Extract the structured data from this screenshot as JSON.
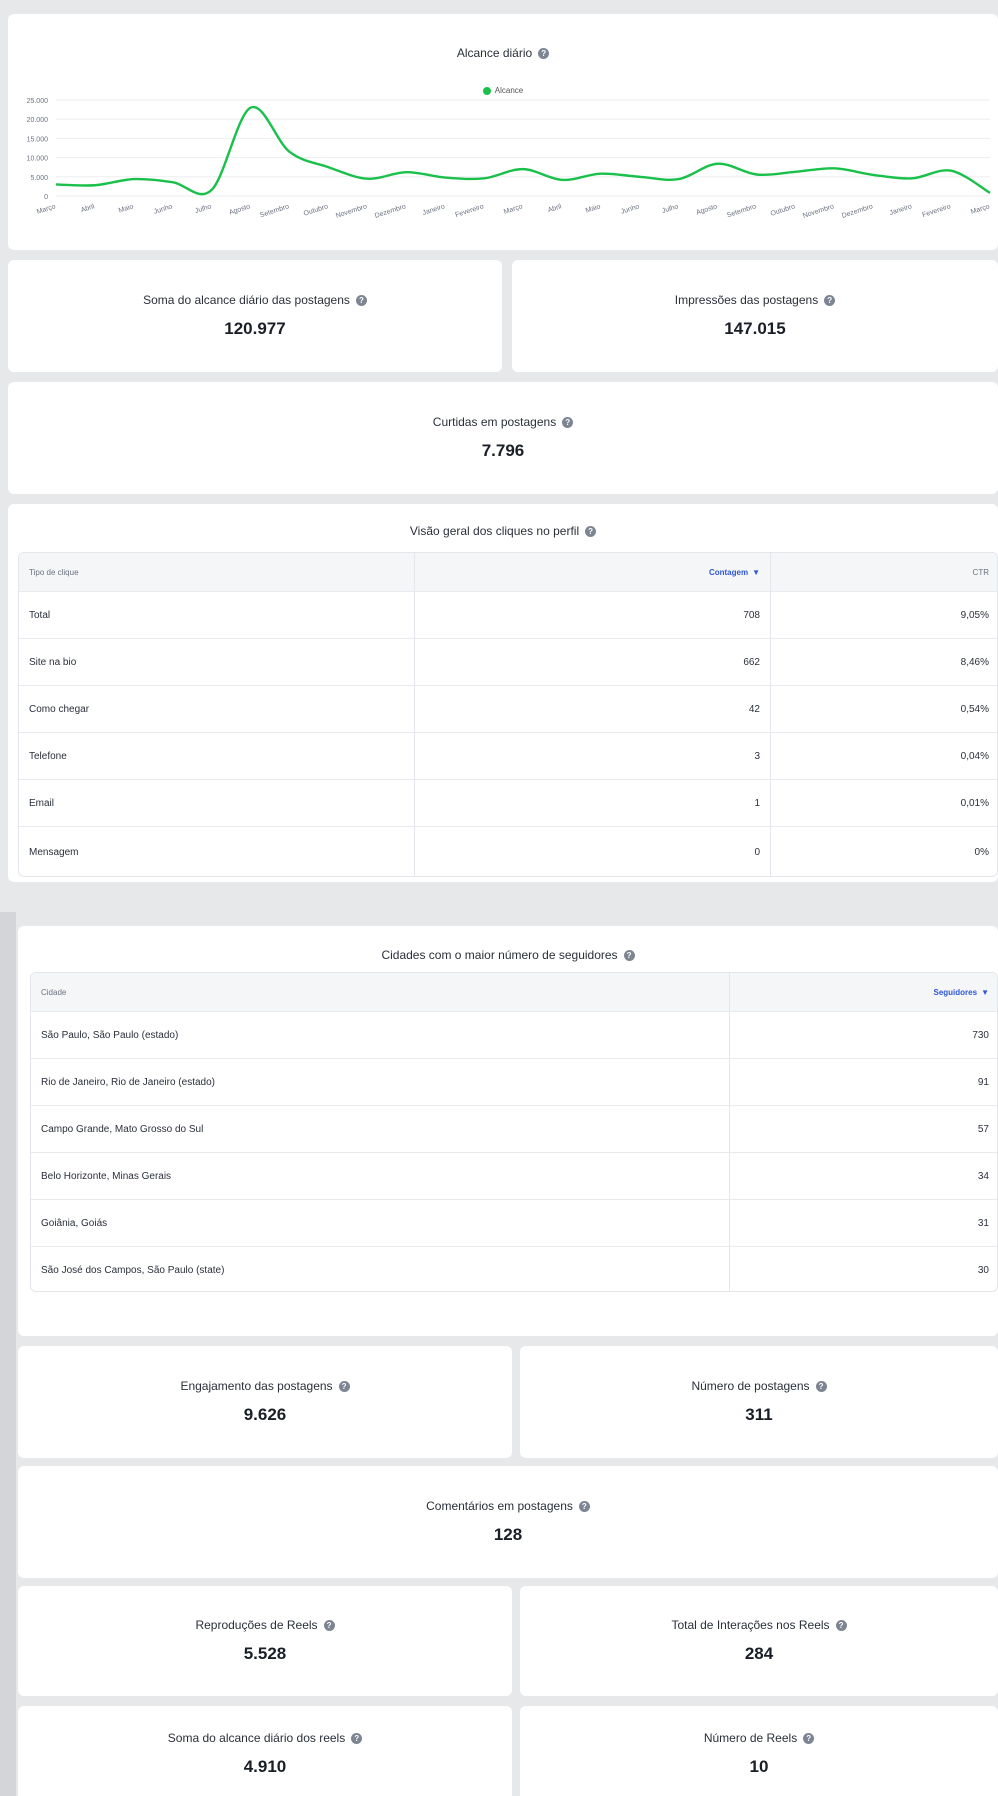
{
  "chart_card": {
    "title": "Alcance diário",
    "legend": "Alcance"
  },
  "chart_data": {
    "type": "line",
    "title": "Alcance diário",
    "series": [
      {
        "name": "Alcance",
        "color": "#19c04a",
        "values": [
          3000,
          2800,
          4400,
          3600,
          1600,
          23000,
          11500,
          7500,
          4500,
          6200,
          4800,
          4600,
          7000,
          4200,
          5800,
          5000,
          4400,
          8400,
          5600,
          6300,
          7200,
          5500,
          4600,
          6600,
          800
        ]
      }
    ],
    "categories": [
      "Março",
      "Abril",
      "Maio",
      "Junho",
      "Julho",
      "Agosto",
      "Setembro",
      "Outubro",
      "Novembro",
      "Dezembro",
      "Janeiro",
      "Fevereiro",
      "Março",
      "Abril",
      "Maio",
      "Junho",
      "Julho",
      "Agosto",
      "Setembro",
      "Outubro",
      "Novembro",
      "Dezembro",
      "Janeiro",
      "Fevereiro",
      "Março"
    ],
    "yticks": [
      "25.000",
      "20.000",
      "15.000",
      "10.000",
      "5.000",
      "0"
    ],
    "ylim": [
      0,
      25000
    ],
    "grid": true,
    "legend_position": "top-center"
  },
  "metrics_top": [
    {
      "label": "Soma do alcance diário das postagens",
      "value": "120.977"
    },
    {
      "label": "Impressões das postagens",
      "value": "147.015"
    },
    {
      "label": "Curtidas em postagens",
      "value": "7.796"
    }
  ],
  "clicks_table": {
    "title": "Visão geral dos cliques no perfil",
    "headers": [
      "Tipo de clique",
      "Contagem",
      "CTR"
    ],
    "rows": [
      [
        "Total",
        "708",
        "9,05%"
      ],
      [
        "Site na bio",
        "662",
        "8,46%"
      ],
      [
        "Como chegar",
        "42",
        "0,54%"
      ],
      [
        "Telefone",
        "3",
        "0,04%"
      ],
      [
        "Email",
        "1",
        "0,01%"
      ],
      [
        "Mensagem",
        "0",
        "0%"
      ]
    ]
  },
  "cities_table": {
    "title": "Cidades com o maior número de seguidores",
    "headers": [
      "Cidade",
      "Seguidores"
    ],
    "rows": [
      [
        "São Paulo, São Paulo (estado)",
        "730"
      ],
      [
        "Rio de Janeiro, Rio de Janeiro (estado)",
        "91"
      ],
      [
        "Campo Grande, Mato Grosso do Sul",
        "57"
      ],
      [
        "Belo Horizonte, Minas Gerais",
        "34"
      ],
      [
        "Goiânia, Goiás",
        "31"
      ],
      [
        "São José dos Campos, São Paulo (state)",
        "30"
      ]
    ]
  },
  "metrics_bottom": [
    {
      "label": "Engajamento das postagens",
      "value": "9.626"
    },
    {
      "label": "Número de postagens",
      "value": "311"
    },
    {
      "label": "Comentários em postagens",
      "value": "128"
    },
    {
      "label": "Reproduções de Reels",
      "value": "5.528"
    },
    {
      "label": "Total de Interações nos Reels",
      "value": "284"
    },
    {
      "label": "Soma do alcance diário dos reels",
      "value": "4.910"
    },
    {
      "label": "Número de Reels",
      "value": "10"
    }
  ],
  "colors": {
    "accent": "#2f56d6",
    "series": "#19c04a",
    "background": "#e7e8ea"
  },
  "icons": {
    "help": "question-circle-icon",
    "sort": "chevron-down-icon"
  }
}
